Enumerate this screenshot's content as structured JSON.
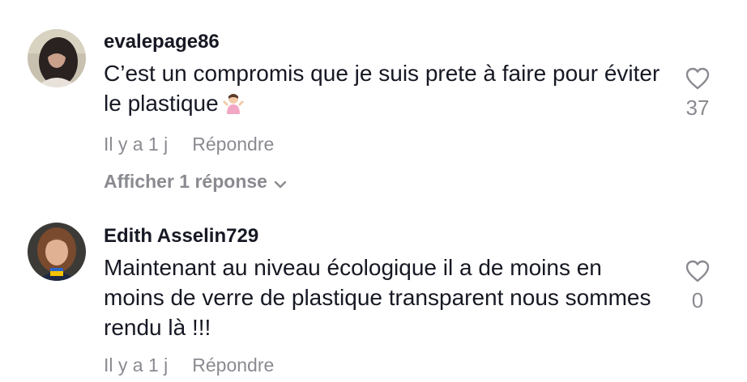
{
  "comments": [
    {
      "username": "evalepage86",
      "text": "C’est un compromis que je suis prete à faire pour éviter le plastique",
      "emoji_icon": "person-shrugging-emoji",
      "time": "Il y a 1 j",
      "reply_label": "Répondre",
      "view_replies_label": "Afficher 1 réponse",
      "like_count": "37"
    },
    {
      "username": "Edith Asselin729",
      "text": "Maintenant au niveau écologique il a de moins en moins de verre de plastique transparent nous sommes rendu là !!!",
      "time": "Il y a 1 j",
      "reply_label": "Répondre",
      "like_count": "0"
    }
  ],
  "colors": {
    "primary_text": "#161823",
    "secondary_text": "#8a8b91"
  }
}
